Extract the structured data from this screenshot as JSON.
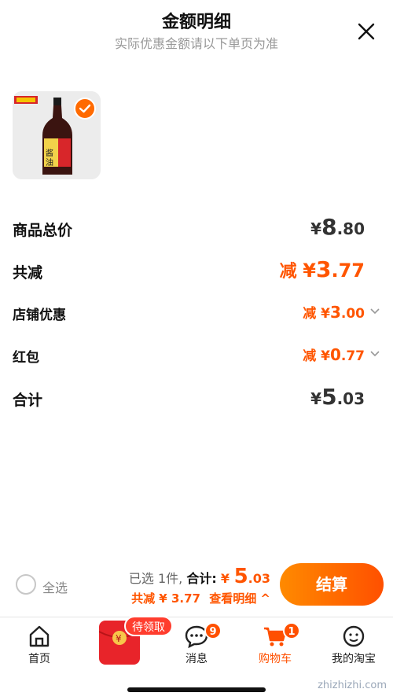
{
  "header": {
    "title": "金额明细",
    "subtitle": "实际优惠金额请以下单页为准"
  },
  "rows": [
    {
      "label": "商品总价",
      "prefix": "",
      "sym": "¥",
      "int": "8",
      "dec": ".80"
    },
    {
      "label": "共减",
      "prefix": "减 ",
      "sym": "¥",
      "int": "3",
      "dec": ".77"
    },
    {
      "label": "店铺优惠",
      "prefix": "减 ",
      "sym": "¥",
      "int": "3",
      "dec": ".00"
    },
    {
      "label": "红包",
      "prefix": "减 ",
      "sym": "¥",
      "int": "0",
      "dec": ".77"
    },
    {
      "label": "合计",
      "prefix": "",
      "sym": "¥",
      "int": "5",
      "dec": ".03"
    }
  ],
  "bottom_bar": {
    "select_all": "全选",
    "selected_count": "已选 1件,",
    "total_label": "合计:",
    "total_sym": "¥",
    "total_int": "5",
    "total_dec": ".03",
    "discount_text": "共减 ¥ 3.77",
    "details_link": "查看明细 ^",
    "checkout": "结算"
  },
  "tabs": [
    {
      "label": "首页",
      "icon": "home-icon"
    },
    {
      "label": "",
      "icon": "red-packet-icon"
    },
    {
      "label": "消息",
      "icon": "message-icon",
      "badge": "9"
    },
    {
      "label": "购物车",
      "icon": "cart-icon",
      "badge": "1"
    },
    {
      "label": "我的淘宝",
      "icon": "profile-icon"
    }
  ],
  "red_packet_tag": "待领取",
  "watermark": "zhizhizhi.com",
  "colors": {
    "accent": "#ff5000",
    "price_dark": "#333333",
    "muted": "#999999"
  }
}
